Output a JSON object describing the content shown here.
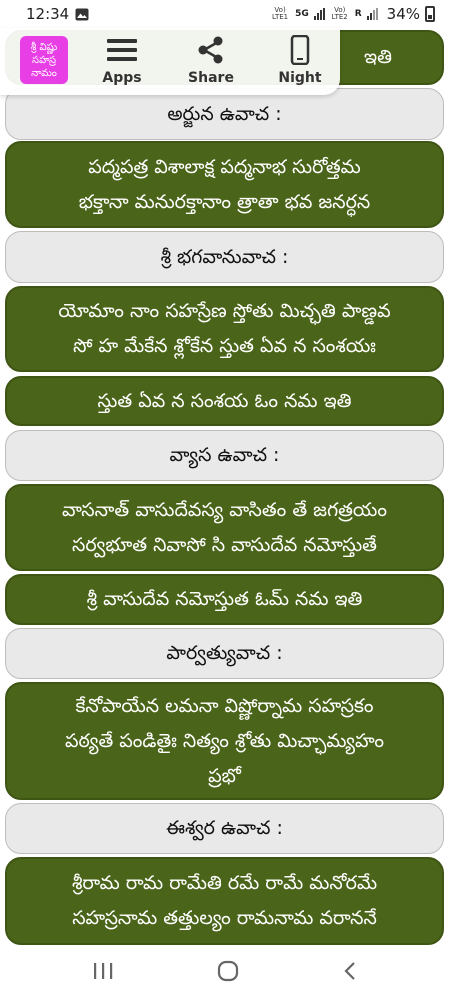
{
  "status": {
    "time": "12:34",
    "sim1": "Vo) LTE1",
    "net1": "5G",
    "sim2": "Vo) LTE2",
    "net2": "R",
    "battery": "34%"
  },
  "toolbar": {
    "logo_text": "శ్రీ విష్ణు\nసహస్ర\nనామం",
    "apps_label": "Apps",
    "share_label": "Share",
    "night_label": "Night"
  },
  "cards": [
    {
      "kind": "verse",
      "text": "ఇతి"
    },
    {
      "kind": "speaker",
      "text": "అర్జున ఉవాచ :"
    },
    {
      "kind": "verse",
      "text": "పద్మపత్ర విశాలాక్ష పద్మనాభ సురోత్తమ\nభక్తానా మనురక్తానాం త్రాతా భవ జనర్ధన"
    },
    {
      "kind": "speaker",
      "text": "శ్రీ భగవానువాచ :"
    },
    {
      "kind": "verse",
      "text": "యోమాం నాం సహస్రేణ స్తోతు మిచ్ఛతి పాణ్డవ\nసో హ మేకేన శ్లోకేన స్తుత ఏవ న సంశయః"
    },
    {
      "kind": "verse",
      "text": "స్తుత ఏవ న సంశయ ఓం నమ ఇతి"
    },
    {
      "kind": "speaker",
      "text": "వ్యాస ఉవాచ :"
    },
    {
      "kind": "verse",
      "text": "వాసనాత్ వాసుదేవస్య వాసితం తే జగత్రయం\nసర్వభూత నివాసో సి వాసుదేవ నమోస్తుతే"
    },
    {
      "kind": "verse",
      "text": "శ్రీ వాసుదేవ నమోస్తుత ఓమ్ నమ ఇతి"
    },
    {
      "kind": "speaker",
      "text": "పార్వత్యువాచ :"
    },
    {
      "kind": "verse",
      "text": "కేనోపాయేన లమనా విష్ణోర్నామ సహస్రకం\nపఠ్యతే పండితైః నిత్యం శ్రోతు మిచ్ఛామ్యహం\nప్రభో"
    },
    {
      "kind": "speaker",
      "text": "ఈశ్వర ఉవాచ :"
    },
    {
      "kind": "verse",
      "text": "శ్రీరామ రామ రామేతి రమే రామే మనోరమే\nసహస్రనామ తత్తుల్యం రామనామ వరాననే"
    }
  ],
  "colors": {
    "verse_bg": "#4a6419",
    "speaker_bg": "#e9e9e9",
    "logo_bg": "#e83ee6"
  }
}
